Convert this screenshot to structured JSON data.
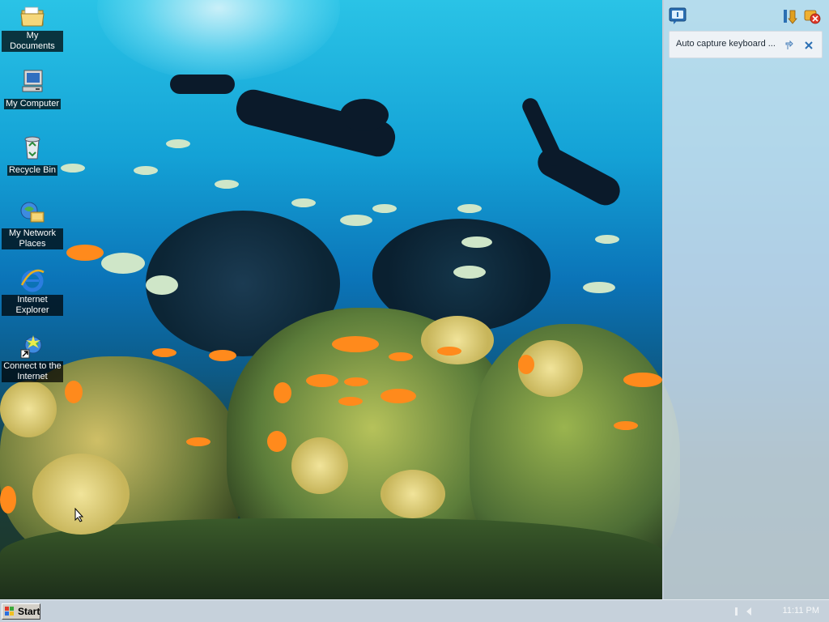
{
  "desktop": {
    "icons": [
      {
        "label": "My Documents",
        "icon": "folder-documents-icon"
      },
      {
        "label": "My Computer",
        "icon": "computer-icon"
      },
      {
        "label": "Recycle Bin",
        "icon": "recycle-bin-icon"
      },
      {
        "label": "My Network Places",
        "icon": "network-places-icon"
      },
      {
        "label": "Internet Explorer",
        "icon": "internet-explorer-icon"
      },
      {
        "label": "Connect to the Internet",
        "icon": "connect-internet-icon"
      }
    ],
    "wallpaper": "underwater-coral-reef-with-divers"
  },
  "side_panel": {
    "header_icons": [
      "chat-bubble-icon",
      "sort-icon",
      "settings-close-icon"
    ],
    "notification": {
      "text": "Auto capture keyboard ...",
      "actions": [
        "pin-icon",
        "close-icon"
      ]
    }
  },
  "taskbar": {
    "start_label": "Start",
    "clock": "11:11 PM"
  },
  "colors": {
    "panel_bg": "#d4e2ee",
    "taskbar_bg": "#c6d1db",
    "accent": "#2b6fb3"
  }
}
